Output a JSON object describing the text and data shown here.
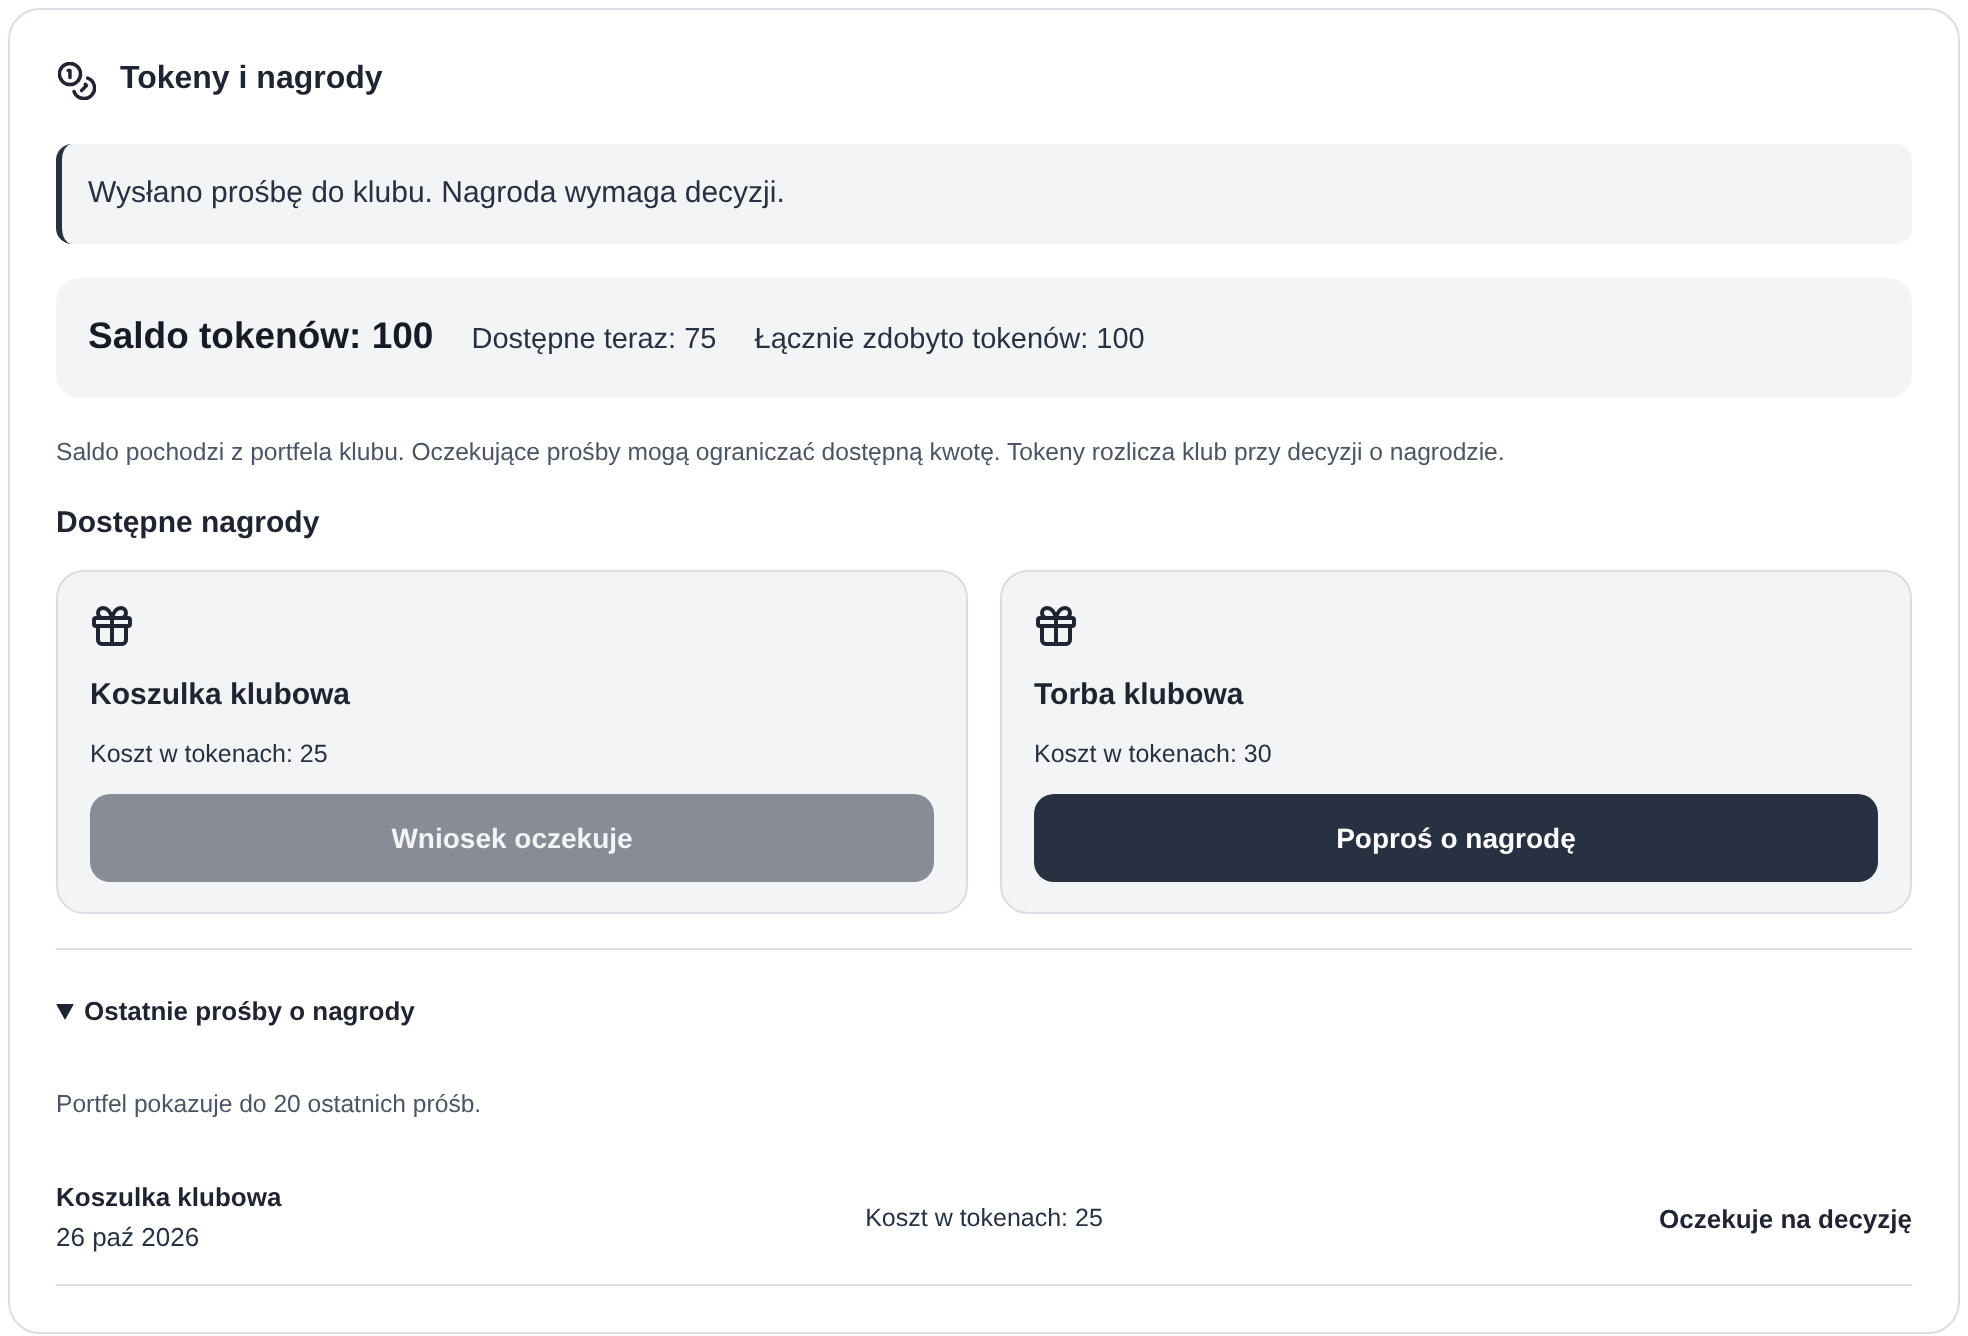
{
  "panel": {
    "title": "Tokeny i nagrody"
  },
  "alert": {
    "text": "Wysłano prośbę do klubu. Nagroda wymaga decyzji."
  },
  "balance": {
    "label": "Saldo tokenów: 100",
    "available": "Dostępne teraz: 75",
    "total": "Łącznie zdobyto tokenów: 100"
  },
  "note": "Saldo pochodzi z portfela klubu. Oczekujące prośby mogą ograniczać dostępną kwotę. Tokeny rozlicza klub przy decyzji o nagrodzie.",
  "rewards": {
    "heading": "Dostępne nagrody",
    "items": [
      {
        "name": "Koszulka klubowa",
        "cost": "Koszt w tokenach: 25",
        "button": "Wniosek oczekuje",
        "disabled": true
      },
      {
        "name": "Torba klubowa",
        "cost": "Koszt w tokenach: 30",
        "button": "Poproś o nagrodę",
        "disabled": false
      }
    ]
  },
  "history": {
    "summary": "Ostatnie prośby o nagrody",
    "expanded": true,
    "note": "Portfel pokazuje do 20 ostatnich próśb.",
    "rows": [
      {
        "name": "Koszulka klubowa",
        "date": "26 paź 2026",
        "cost": "Koszt w tokenach: 25",
        "status": "Oczekuje na decyzję"
      }
    ]
  }
}
